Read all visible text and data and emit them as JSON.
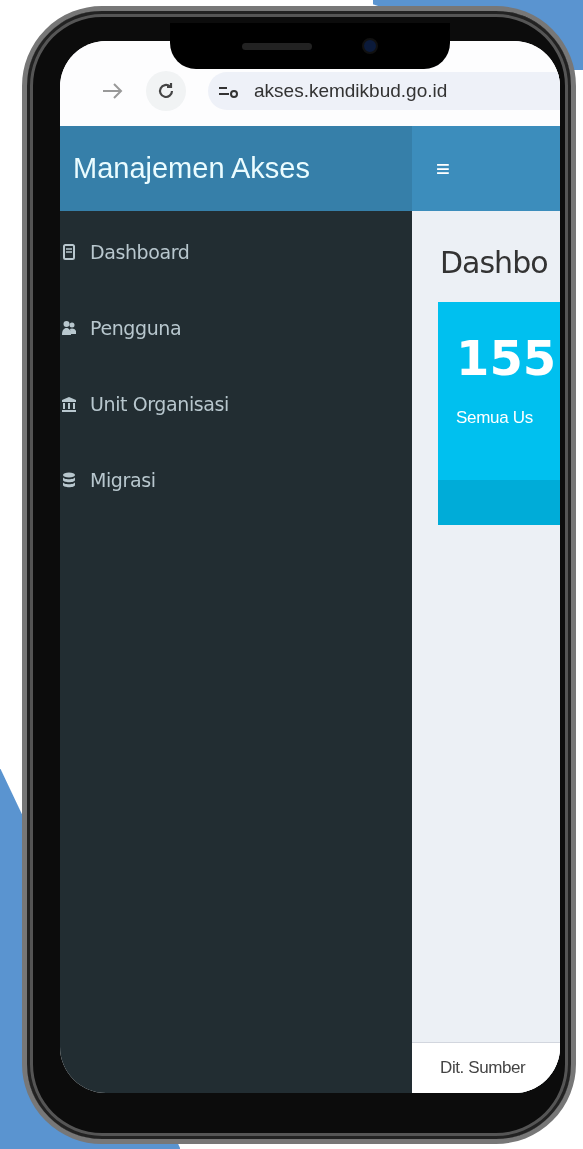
{
  "browser": {
    "url": "akses.kemdikbud.go.id"
  },
  "header": {
    "brand": "Manajemen Akses",
    "menu_icon": "≡"
  },
  "sidebar": {
    "items": [
      {
        "label": "Dashboard",
        "kind": "dashboard"
      },
      {
        "label": "Pengguna",
        "kind": "users"
      },
      {
        "label": "Unit Organisasi",
        "kind": "institution"
      },
      {
        "label": "Migrasi",
        "kind": "database"
      }
    ]
  },
  "content": {
    "title": "Dashbo",
    "stat_card": {
      "value": "155",
      "label": "Semua Us"
    }
  },
  "footer": {
    "text": "Dit. Sumber"
  }
}
